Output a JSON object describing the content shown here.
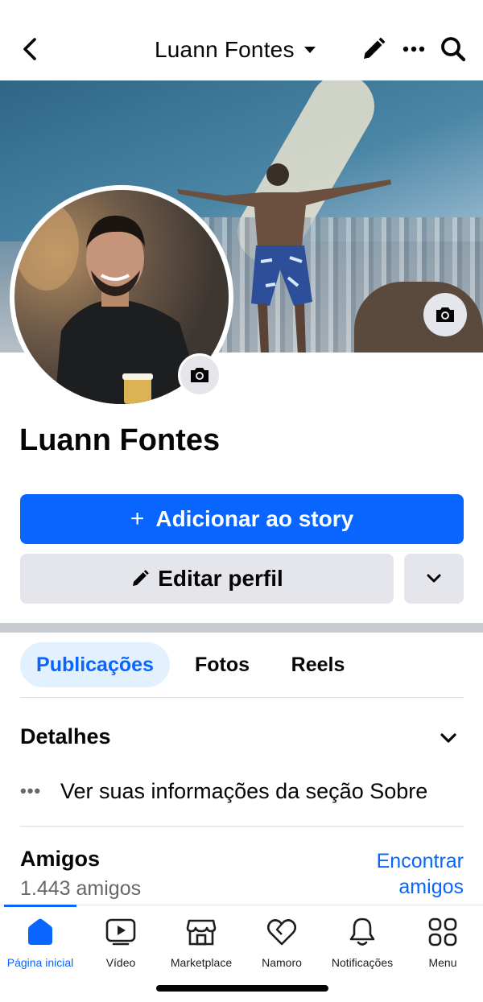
{
  "header": {
    "title": "Luann Fontes"
  },
  "profile": {
    "name": "Luann Fontes"
  },
  "actions": {
    "add_story_label": "Adicionar ao story",
    "add_story_plus": "+",
    "edit_profile_label": "Editar perfil"
  },
  "tabs": [
    {
      "label": "Publicações",
      "active": true
    },
    {
      "label": "Fotos",
      "active": false
    },
    {
      "label": "Reels",
      "active": false
    }
  ],
  "details": {
    "title": "Detalhes",
    "dots": "•••",
    "about_text": "Ver suas informações da seção Sobre"
  },
  "friends": {
    "title": "Amigos",
    "count_text": "1.443 amigos",
    "find_line1": "Encontrar",
    "find_line2": "amigos"
  },
  "bottom_nav": [
    {
      "label": "Página inicial",
      "icon": "home-icon",
      "active": true
    },
    {
      "label": "Vídeo",
      "icon": "video-icon",
      "active": false
    },
    {
      "label": "Marketplace",
      "icon": "marketplace-icon",
      "active": false
    },
    {
      "label": "Namoro",
      "icon": "dating-heart-icon",
      "active": false
    },
    {
      "label": "Notificações",
      "icon": "bell-icon",
      "active": false
    },
    {
      "label": "Menu",
      "icon": "menu-grid-icon",
      "active": false
    }
  ],
  "colors": {
    "accent": "#0866ff",
    "active_tab_bg": "#e3f0fd",
    "secondary_button": "#e4e6eb",
    "text_primary": "#050505",
    "text_secondary": "#65676b"
  }
}
